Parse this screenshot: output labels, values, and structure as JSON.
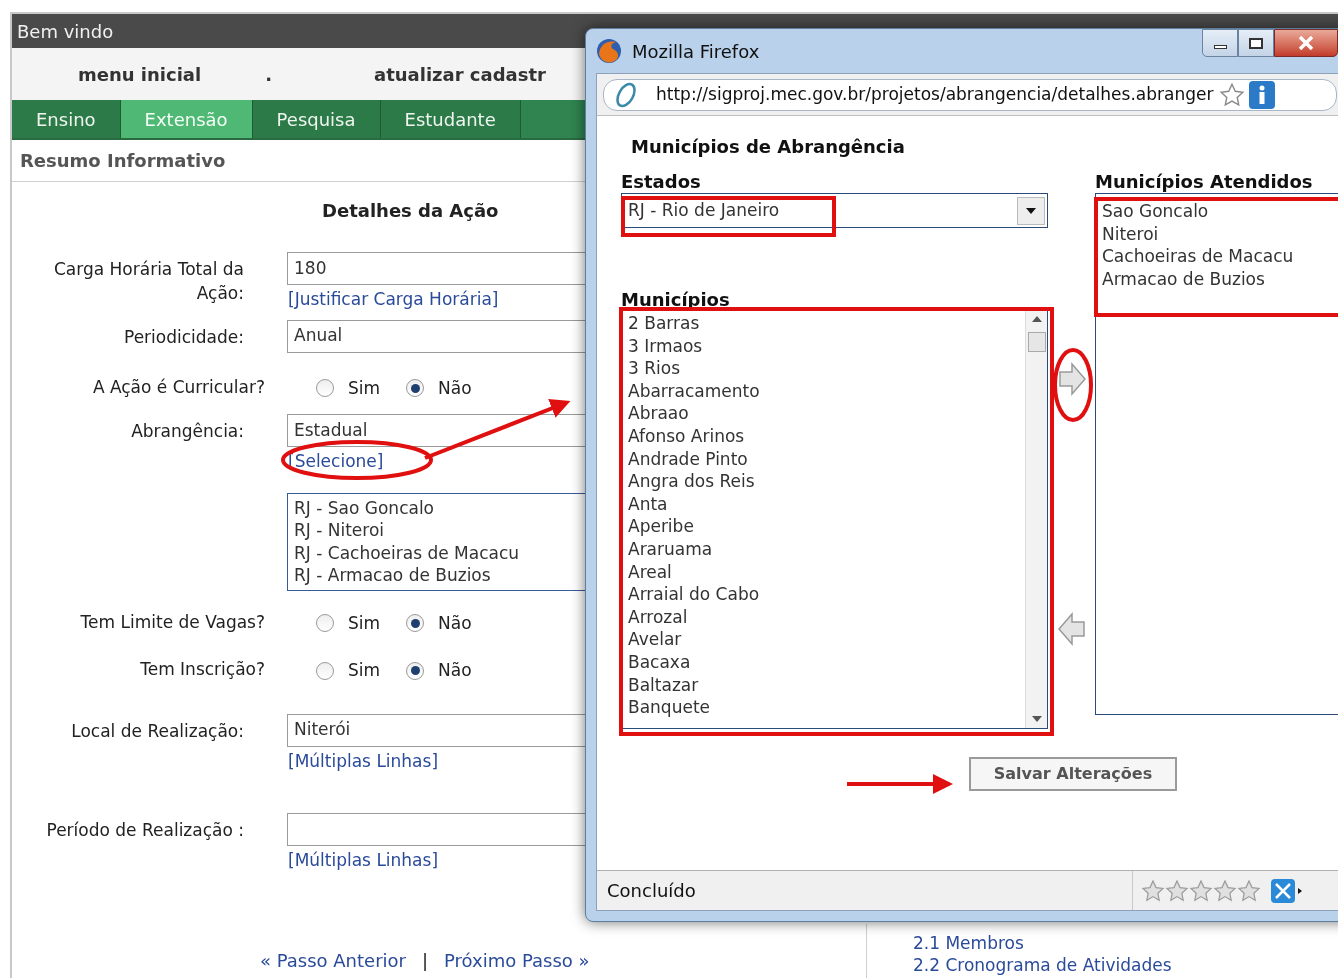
{
  "page": {
    "header_title": "Bem vindo",
    "menu_links": [
      "menu inicial",
      ".",
      "atualizar cadastr"
    ],
    "tabs": [
      {
        "label": "Ensino",
        "selected": false
      },
      {
        "label": "Extensão",
        "selected": true
      },
      {
        "label": "Pesquisa",
        "selected": false
      },
      {
        "label": "Estudante",
        "selected": false
      }
    ],
    "section_title": "Resumo Informativo",
    "form_title": "Detalhes da Ação",
    "fields": [
      {
        "kind": "text",
        "label": "Carga Horária Total da Ação:",
        "value": "180",
        "link": "[Justificar Carga Horária]"
      },
      {
        "kind": "text",
        "label": "Periodicidade:",
        "value": "Anual"
      },
      {
        "kind": "radio",
        "label": "A Ação é Curricular?",
        "options": [
          {
            "label": "Sim",
            "selected": false
          },
          {
            "label": "Não",
            "selected": true
          }
        ]
      },
      {
        "kind": "text",
        "label": "Abrangência:",
        "value": "Estadual",
        "link": "[Selecione]",
        "list": [
          "RJ - Sao Goncalo",
          "RJ - Niteroi",
          "RJ - Cachoeiras de Macacu",
          "RJ - Armacao de Buzios"
        ]
      },
      {
        "kind": "radio",
        "label": "Tem Limite de Vagas?",
        "options": [
          {
            "label": "Sim",
            "selected": false
          },
          {
            "label": "Não",
            "selected": true
          }
        ]
      },
      {
        "kind": "radio",
        "label": "Tem Inscrição?",
        "options": [
          {
            "label": "Sim",
            "selected": false
          },
          {
            "label": "Não",
            "selected": true
          }
        ]
      },
      {
        "kind": "text",
        "label": "Local de Realização:",
        "value": "Niterói",
        "link": "[Múltiplas Linhas]"
      },
      {
        "kind": "text",
        "label": "Período de Realização :",
        "link": "[Múltiplas Linhas]"
      }
    ],
    "nav": {
      "previous": "« Passo Anterior",
      "separator": "|",
      "next": "Próximo Passo »"
    },
    "side_links": [
      "2.1 Membros",
      "2.2 Cronograma de Atividades"
    ]
  },
  "popup": {
    "title": "Mozilla Firefox",
    "url": "http://sigproj.mec.gov.br/projetos/abrangencia/detalhes.abranger",
    "heading": "Municípios de Abrangência",
    "states_label": "Estados",
    "state_value": "RJ - Rio de Janeiro",
    "municipalities_label": "Municípios",
    "municipalities": [
      "2 Barras",
      "3 Irmaos",
      "3 Rios",
      "Abarracamento",
      "Abraao",
      "Afonso Arinos",
      "Andrade Pinto",
      "Angra dos Reis",
      "Anta",
      "Aperibe",
      "Araruama",
      "Areal",
      "Arraial do Cabo",
      "Arrozal",
      "Avelar",
      "Bacaxa",
      "Baltazar",
      "Banquete"
    ],
    "served_label": "Municípios Atendidos",
    "served": [
      "Sao Goncalo",
      "Niteroi",
      "Cachoeiras de Macacu",
      "Armacao de Buzios"
    ],
    "save_button": "Salvar Alterações",
    "status": "Concluído",
    "stars": 0
  }
}
